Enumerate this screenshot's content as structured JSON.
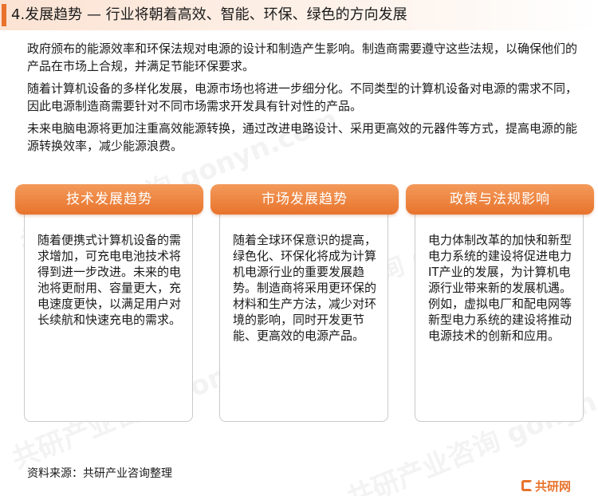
{
  "header": {
    "title": "4.发展趋势 — 行业将朝着高效、智能、环保、绿色的方向发展"
  },
  "intro": {
    "paragraphs": [
      "政府颁布的能源效率和环保法规对电源的设计和制造产生影响。制造商需要遵守这些法规，以确保他们的产品在市场上合规，并满足节能环保要求。",
      "随着计算机设备的多样化发展，电源市场也将进一步细分化。不同类型的计算机设备对电源的需求不同，因此电源制造商需要针对不同市场需求开发具有针对性的产品。",
      "未来电脑电源将更加注重高效能源转换，通过改进电路设计、采用更高效的元器件等方式，提高电源的能源转换效率，减少能源浪费。"
    ]
  },
  "cards": [
    {
      "title": "技术发展趋势",
      "body": "随着便携式计算机设备的需求增加，可充电电池技术将得到进一步改进。未来的电池将更耐用、容量更大，充电速度更快，以满足用户对长续航和快速充电的需求。"
    },
    {
      "title": "市场发展趋势",
      "body": "随着全球环保意识的提高，绿色化、环保化将成为计算机电源行业的重要发展趋势。制造商将采用更环保的材料和生产方法，减少对环境的影响，同时开发更节能、更高效的电源产品。"
    },
    {
      "title": "政策与法规影响",
      "body": "电力体制改革的加快和新型电力系统的建设将促进电力IT产业的发展，为计算机电源行业带来新的发展机遇。例如，虚拟电厂和配电网等新型电力系统的建设将推动电源技术的创新和应用。"
    }
  ],
  "footer": {
    "source": "资料来源：共研产业咨询整理",
    "logo_text": "共研网"
  },
  "watermark": {
    "text": "共研产业咨询 gonyn.com"
  },
  "colors": {
    "accent": "#e8732c",
    "card_border": "#c9c9c9"
  }
}
